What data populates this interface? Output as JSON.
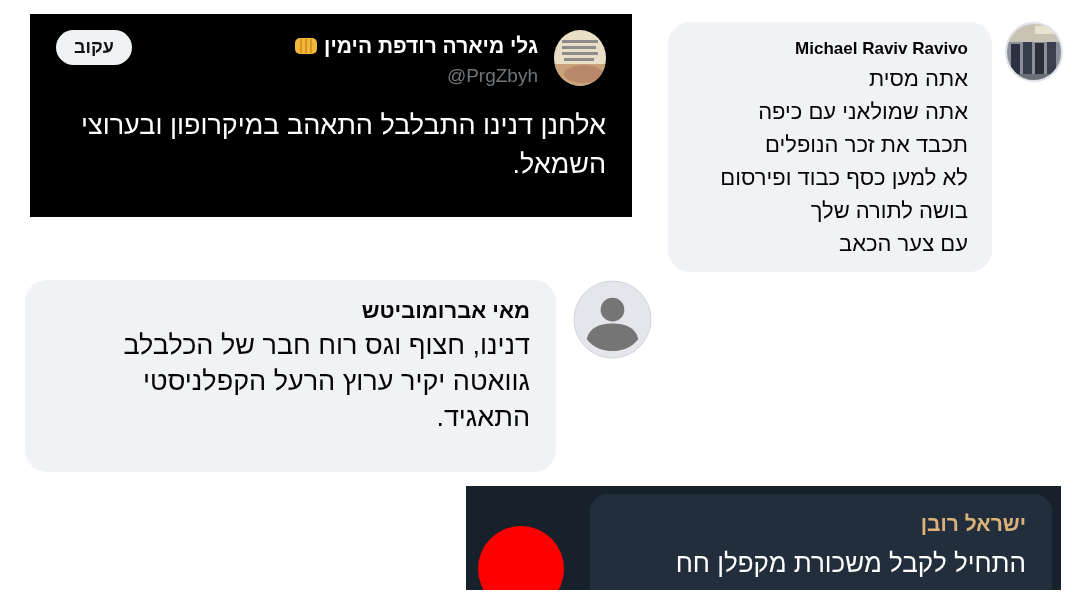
{
  "tweet": {
    "author": "גלי מיארה רודפת הימין",
    "handle": "@PrgZbyh",
    "follow_button": "עקוב",
    "text": "אלחנן דנינו התבלבל התאהב במיקרופון ובערוצי השמאל."
  },
  "comments": [
    {
      "author": "Michael Raviv Ravivo",
      "lines": [
        "אתה מסית",
        "אתה שמולאני עם כיפה",
        "תכבד את זכר הנופלים",
        "לא למען כסף כבוד ופירסום",
        "בושה לתורה שלך",
        "עם צער הכאב"
      ],
      "kind": "picture"
    },
    {
      "author": "מאי אברומוביטש",
      "lines": [
        "דנינו, חצוף וגס רוח חבר של הכלבלב",
        "גוואטה יקיר ערוץ הרעל הקפלניסטי",
        "התאגיד."
      ],
      "kind": "silhouette"
    }
  ],
  "telegram": {
    "author": "ישראל רובן",
    "text": "התחיל לקבל משכורת מקפלן חח",
    "color": "#ff0000"
  }
}
